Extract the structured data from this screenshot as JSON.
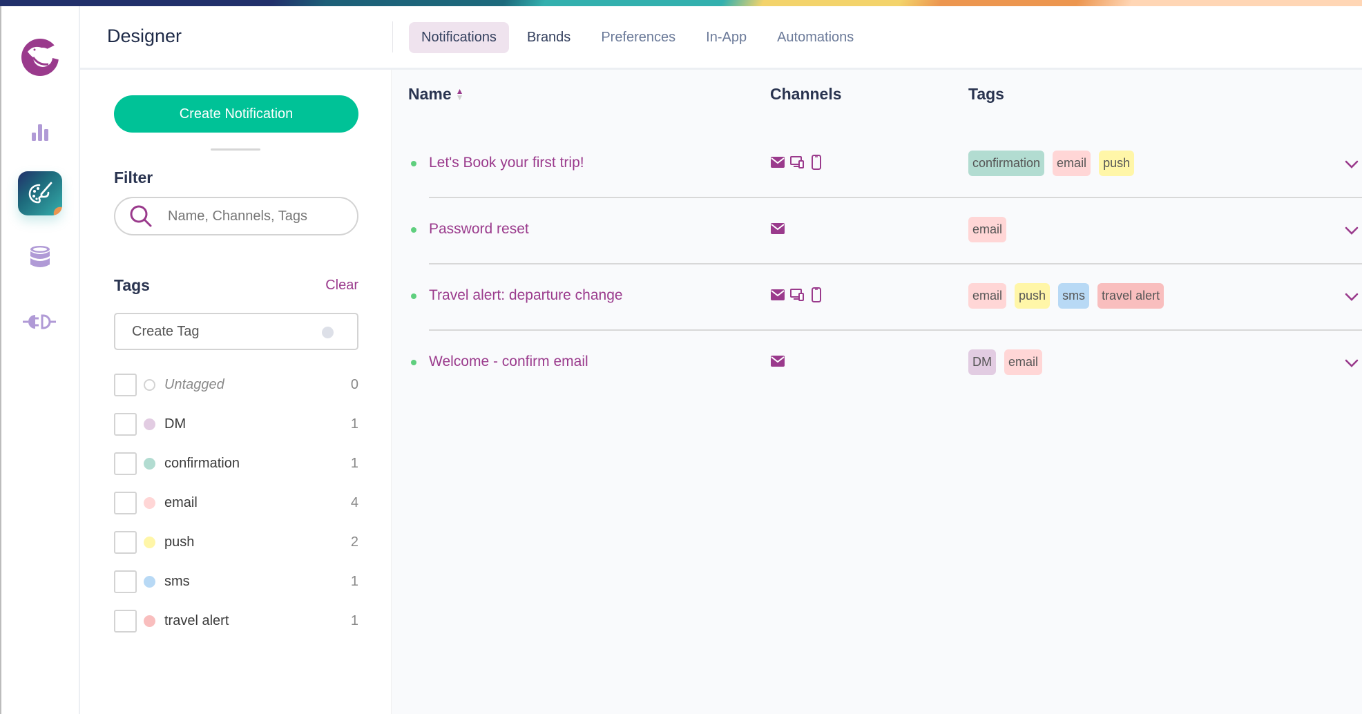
{
  "app": {
    "title": "Designer"
  },
  "colors": {
    "accent": "#9a3a8c",
    "primary_button": "#00c297",
    "status_active": "#5fcf7e",
    "rail_icon": "#b09ad6"
  },
  "rail": {
    "items": [
      {
        "name": "logo",
        "icon": "bird-logo-icon"
      },
      {
        "name": "analytics",
        "icon": "bar-chart-icon"
      },
      {
        "name": "designer",
        "icon": "palette-icon",
        "active": true
      },
      {
        "name": "data",
        "icon": "database-icon"
      },
      {
        "name": "integrations",
        "icon": "plug-icon"
      }
    ]
  },
  "tabs": [
    {
      "label": "Notifications",
      "active": true
    },
    {
      "label": "Brands"
    },
    {
      "label": "Preferences"
    },
    {
      "label": "In-App"
    },
    {
      "label": "Automations"
    }
  ],
  "left_panel": {
    "create_button": "Create Notification",
    "filter_title": "Filter",
    "search_placeholder": "Name, Channels, Tags",
    "tags_title": "Tags",
    "clear_label": "Clear",
    "create_tag_placeholder": "Create Tag",
    "tags": [
      {
        "name": "Untagged",
        "count": "0",
        "color": null
      },
      {
        "name": "DM",
        "count": "1",
        "color": "#e2cce2"
      },
      {
        "name": "confirmation",
        "count": "1",
        "color": "#b2dcd1"
      },
      {
        "name": "email",
        "count": "4",
        "color": "#ffd6d6"
      },
      {
        "name": "push",
        "count": "2",
        "color": "#fff6a8"
      },
      {
        "name": "sms",
        "count": "1",
        "color": "#b8d9f5"
      },
      {
        "name": "travel alert",
        "count": "1",
        "color": "#f9bebe"
      }
    ]
  },
  "table": {
    "headers": {
      "name": "Name",
      "channels": "Channels",
      "tags": "Tags"
    },
    "sort": {
      "column": "Name",
      "direction": "ascending"
    },
    "rows": [
      {
        "name": "Let's Book your first trip!",
        "channels": [
          "email",
          "push",
          "sms"
        ],
        "tags": [
          "confirmation",
          "email",
          "push"
        ]
      },
      {
        "name": "Password reset",
        "channels": [
          "email"
        ],
        "tags": [
          "email"
        ]
      },
      {
        "name": "Travel alert: departure change",
        "channels": [
          "email",
          "push",
          "sms"
        ],
        "tags": [
          "email",
          "push",
          "sms",
          "travel alert"
        ]
      },
      {
        "name": "Welcome - confirm email",
        "channels": [
          "email"
        ],
        "tags": [
          "DM",
          "email"
        ]
      }
    ]
  }
}
